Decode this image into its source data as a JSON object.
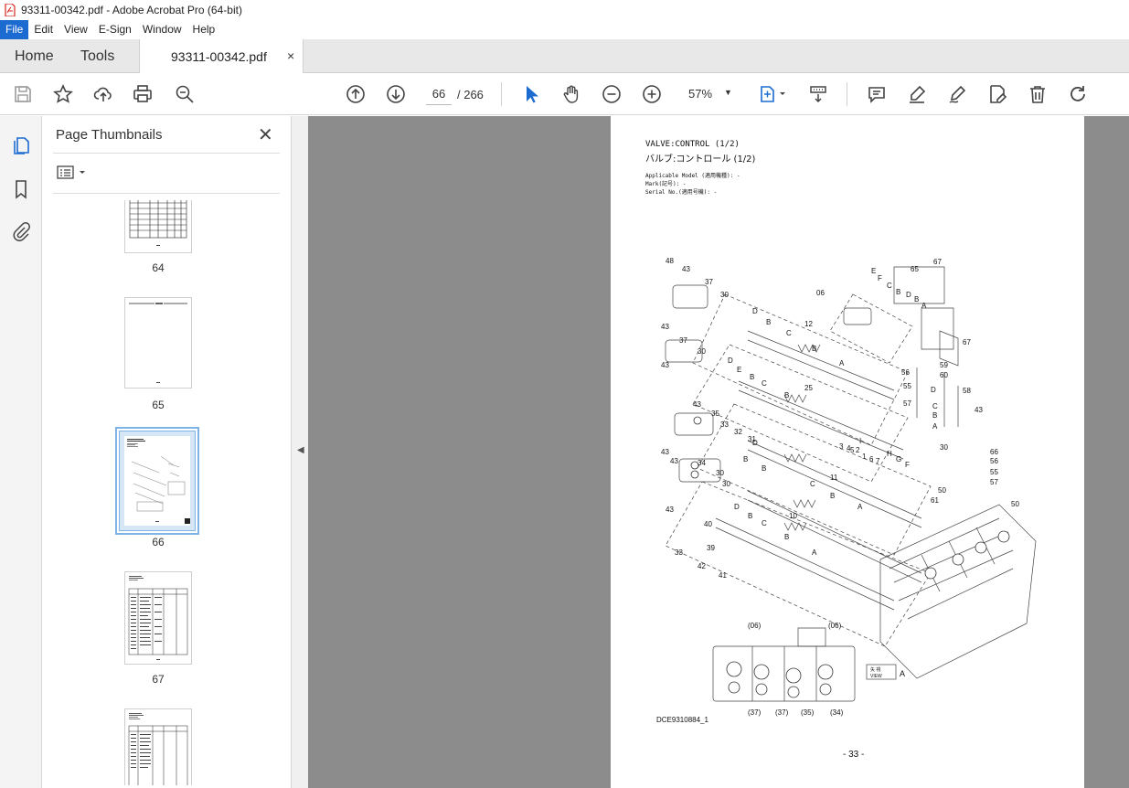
{
  "window": {
    "title": "93311-00342.pdf - Adobe Acrobat Pro (64-bit)"
  },
  "menu": {
    "items": [
      "File",
      "Edit",
      "View",
      "E-Sign",
      "Window",
      "Help"
    ]
  },
  "tabs": {
    "home": "Home",
    "tools": "Tools",
    "document": "93311-00342.pdf",
    "close": "×"
  },
  "toolbar": {
    "page_current": "66",
    "page_of": "/  266",
    "zoom": "57%"
  },
  "thumbnails": {
    "title": "Page Thumbnails",
    "items": [
      {
        "label": "64"
      },
      {
        "label": "65"
      },
      {
        "label": "66",
        "selected": true
      },
      {
        "label": "67"
      }
    ]
  },
  "document": {
    "heading": "VALVE:CONTROL (1/2)",
    "heading_jp": "バルブ:コントロール (1/2)",
    "applicable_model": "Applicable Model (適用機種): -",
    "mark": "Mark(記号): -",
    "serial": "Serial No.(適用号機): -",
    "drawing_code": "DCE9310884_1",
    "page_number": "- 33 -",
    "view_label": "VIEW",
    "view_letter": "A",
    "view_jp": "矢 視",
    "callouts_bottom": [
      "(06)",
      "(06)",
      "(37)",
      "(37)",
      "(35)",
      "(34)"
    ],
    "callouts": [
      "48",
      "43",
      "37",
      "30",
      "A",
      "43",
      "37",
      "30",
      "43",
      "43",
      "35",
      "33",
      "32",
      "31",
      "43",
      "34",
      "30",
      "30",
      "43",
      "40",
      "33",
      "39",
      "42",
      "41",
      "06",
      "12",
      "25",
      "11",
      "10",
      "D",
      "B",
      "C",
      "B",
      "A",
      "E",
      "F",
      "D",
      "B",
      "A",
      "C",
      "B",
      "A",
      "65",
      "67",
      "E",
      "D",
      "C",
      "B",
      "A",
      "59",
      "60",
      "56",
      "55",
      "57",
      "58",
      "43",
      "66",
      "56",
      "55",
      "57",
      "50",
      "61",
      "50",
      "3",
      "4",
      "5",
      "2",
      "1",
      "6",
      "7",
      "H",
      "G",
      "F",
      "I",
      "(06)",
      "(06)",
      "(37)",
      "(37)",
      "(35)",
      "(34)"
    ]
  },
  "colors": {
    "accent": "#1c6bd1",
    "doc_bg": "#8c8c8c",
    "selected_thumb": "#7fb4e8"
  }
}
